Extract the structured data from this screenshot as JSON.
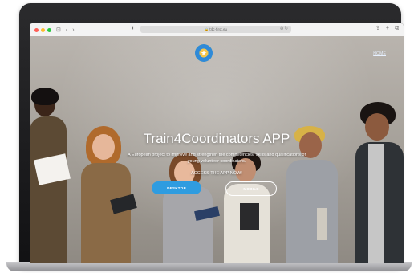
{
  "browser": {
    "address": "🔒 t4c-first.eu",
    "nav_back": "‹",
    "nav_forward": "›",
    "reader_icon": "⊡",
    "shield_icon": "◐",
    "share_icon": "⇪",
    "new_tab_icon": "+",
    "tabs_icon": "⧉",
    "addr_right_icon": "⊕ ↻",
    "traffic_colors": [
      "#ff5f57",
      "#febc2e",
      "#28c840"
    ]
  },
  "site": {
    "logo_glyph": "★",
    "home_link": "HOME",
    "title": "Train4Coordinators APP",
    "subtitle": "A European project to improve and strengthen the competencies, skills and qualifications of young volunteer coordinators.",
    "cta_text": "ACCESS THE APP NOW!",
    "buttons": {
      "desktop": "DESKTOP",
      "mobile": "MOBILE"
    },
    "colors": {
      "accent": "#2f9ce0",
      "text": "#ffffff"
    }
  }
}
